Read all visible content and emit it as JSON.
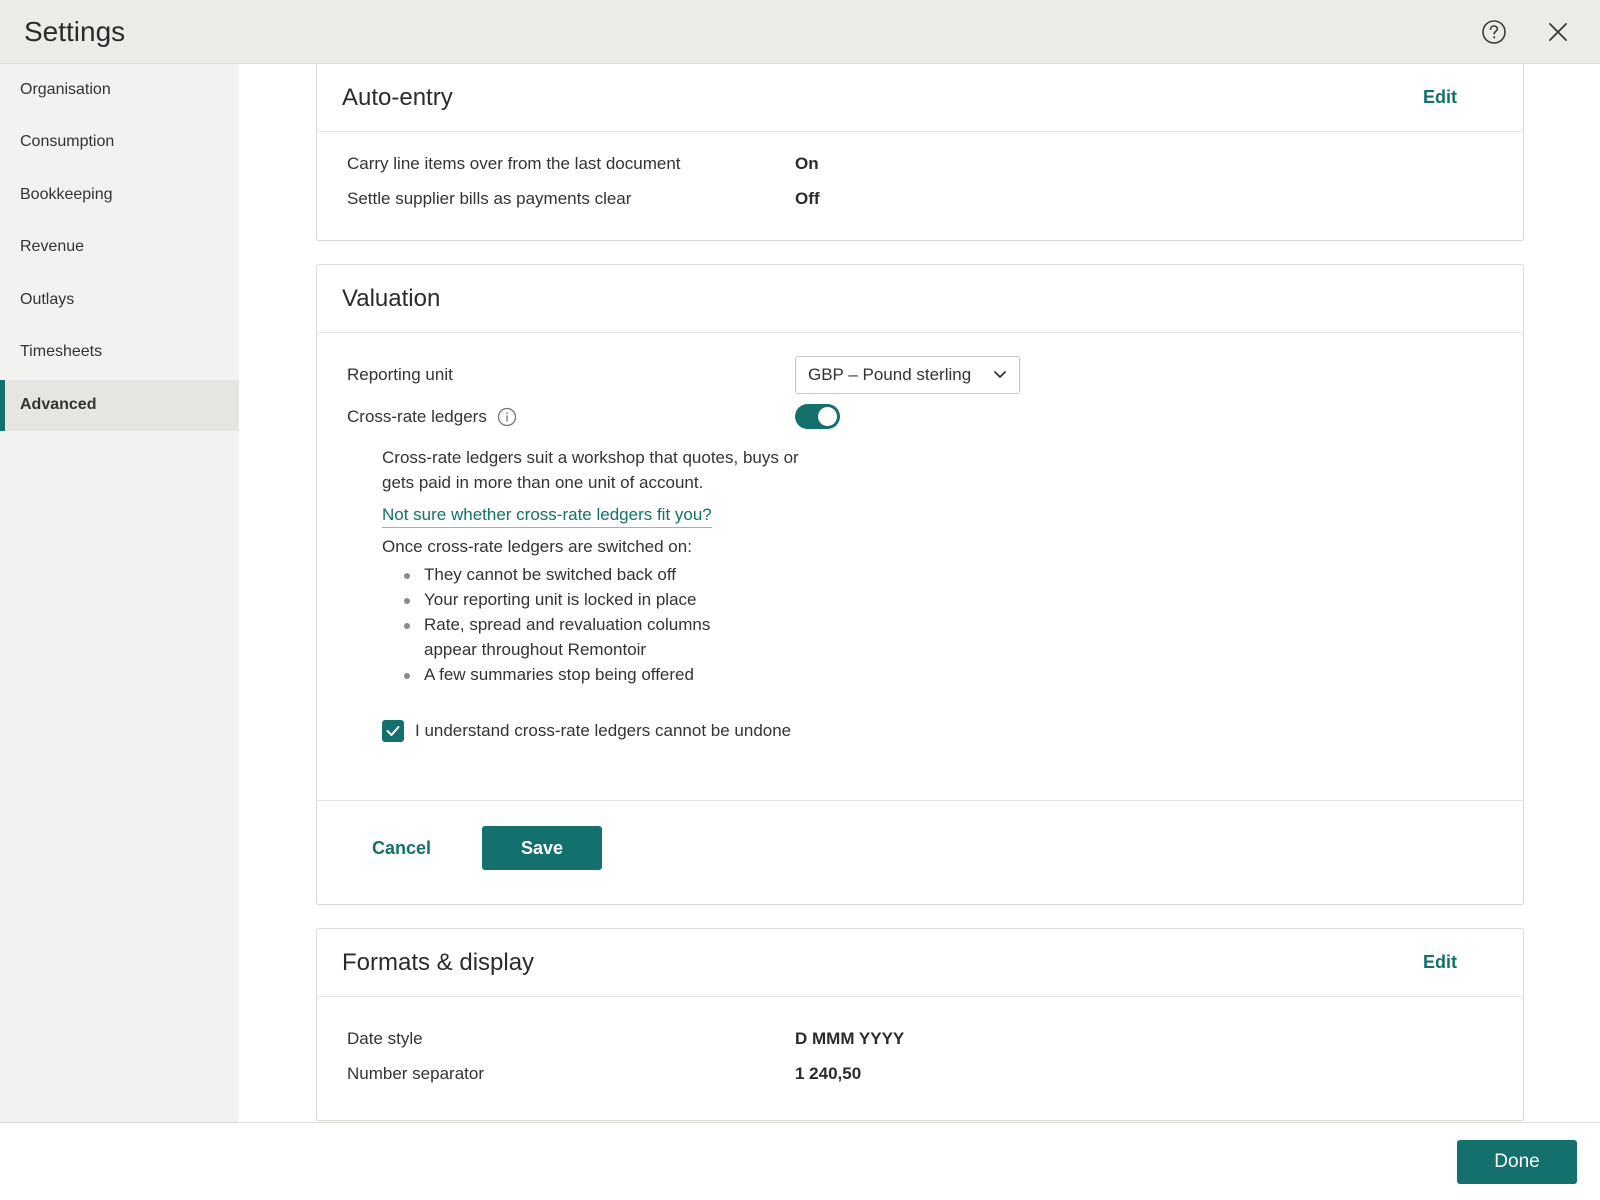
{
  "header": {
    "title": "Settings",
    "help_icon": "help-circle-icon",
    "close_icon": "close-icon"
  },
  "sidebar": {
    "items": [
      {
        "label": "Organisation"
      },
      {
        "label": "Consumption"
      },
      {
        "label": "Bookkeeping"
      },
      {
        "label": "Revenue"
      },
      {
        "label": "Outlays"
      },
      {
        "label": "Timesheets"
      },
      {
        "label": "Advanced"
      }
    ],
    "active_index": 6
  },
  "auto_entry": {
    "title": "Auto-entry",
    "edit_label": "Edit",
    "rows": [
      {
        "label": "Carry line items over from the last document",
        "value": "On"
      },
      {
        "label": "Settle supplier bills as payments clear",
        "value": "Off"
      }
    ]
  },
  "valuation": {
    "title": "Valuation",
    "reporting_unit_label": "Reporting unit",
    "reporting_unit_value": "GBP – Pound sterling",
    "cross_rate_label": "Cross-rate ledgers",
    "cross_rate_enabled": true,
    "description": "Cross-rate ledgers suit a workshop that quotes, buys or gets paid in more than one unit of account.",
    "learn_link": "Not sure whether cross-rate ledgers fit you?",
    "once_intro": "Once cross-rate ledgers are switched on:",
    "bullets": [
      "They cannot be switched back off",
      "Your reporting unit is locked in place",
      "Rate, spread and revaluation columns appear throughout Remontoir",
      "A few summaries stop being offered"
    ],
    "confirm_label": "I understand cross-rate ledgers cannot be undone",
    "confirm_checked": true,
    "cancel_label": "Cancel",
    "save_label": "Save"
  },
  "formats": {
    "title": "Formats & display",
    "edit_label": "Edit",
    "rows": [
      {
        "label": "Date style",
        "value": "D MMM YYYY"
      },
      {
        "label": "Number separator",
        "value": "1 240,50"
      }
    ]
  },
  "footer": {
    "done_label": "Done"
  },
  "colors": {
    "accent": "#13706c",
    "header_bg": "#ecebe8",
    "sidebar_bg": "#f2f2f0"
  }
}
